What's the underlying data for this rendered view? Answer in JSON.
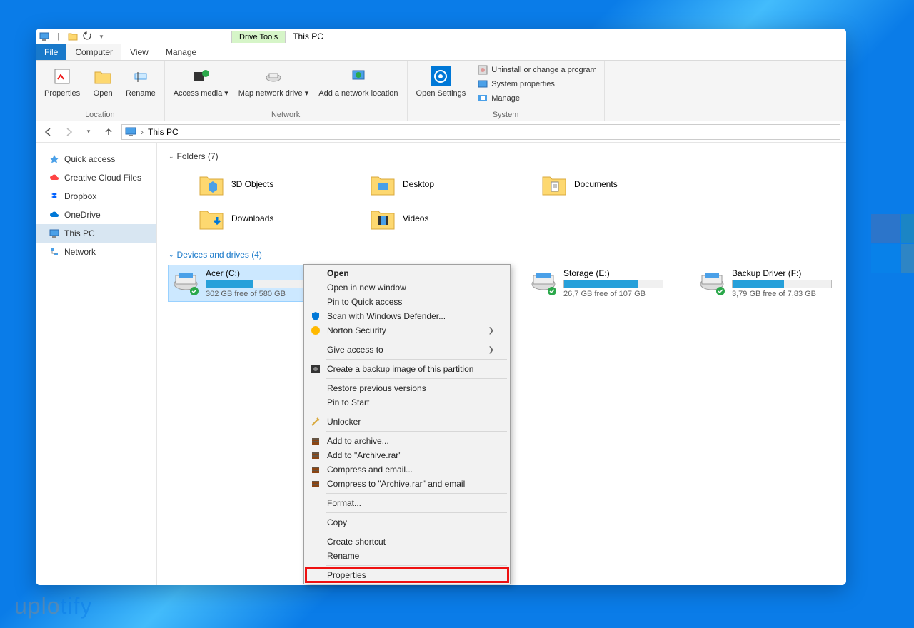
{
  "window": {
    "drive_tools": "Drive Tools",
    "title": "This PC"
  },
  "tabs": {
    "file": "File",
    "computer": "Computer",
    "view": "View",
    "manage": "Manage"
  },
  "ribbon": {
    "location": {
      "properties": "Properties",
      "open": "Open",
      "rename": "Rename",
      "group": "Location"
    },
    "network": {
      "access_media": "Access media",
      "map_drive": "Map network drive",
      "add_location": "Add a network location",
      "group": "Network"
    },
    "system": {
      "open_settings": "Open Settings",
      "uninstall": "Uninstall or change a program",
      "sys_props": "System properties",
      "manage": "Manage",
      "group": "System"
    }
  },
  "breadcrumb": {
    "this_pc": "This PC"
  },
  "sidebar": {
    "items": [
      {
        "label": "Quick access"
      },
      {
        "label": "Creative Cloud Files"
      },
      {
        "label": "Dropbox"
      },
      {
        "label": "OneDrive"
      },
      {
        "label": "This PC"
      },
      {
        "label": "Network"
      }
    ]
  },
  "sections": {
    "folders": {
      "header": "Folders (7)",
      "items": [
        "3D Objects",
        "Desktop",
        "Documents",
        "Downloads",
        "Videos"
      ]
    },
    "devices": {
      "header": "Devices and drives (4)",
      "drives": [
        {
          "name": "Acer (C:)",
          "free": "302 GB free of 580 GB",
          "pct": 48
        },
        {
          "name": "Storage (E:)",
          "free": "26,7 GB free of 107 GB",
          "pct": 75
        },
        {
          "name": "Backup Driver (F:)",
          "free": "3,79 GB free of 7,83 GB",
          "pct": 52
        }
      ]
    }
  },
  "context_menu": {
    "open": "Open",
    "open_new": "Open in new window",
    "pin_quick": "Pin to Quick access",
    "defender": "Scan with Windows Defender...",
    "norton": "Norton Security",
    "give_access": "Give access to",
    "backup_image": "Create a backup image of this partition",
    "restore": "Restore previous versions",
    "pin_start": "Pin to Start",
    "unlocker": "Unlocker",
    "add_archive": "Add to archive...",
    "add_archive_rar": "Add to \"Archive.rar\"",
    "compress_email": "Compress and email...",
    "compress_rar_email": "Compress to \"Archive.rar\" and email",
    "format": "Format...",
    "copy": "Copy",
    "create_shortcut": "Create shortcut",
    "rename": "Rename",
    "properties": "Properties"
  },
  "watermark": {
    "a": "uplo",
    "b": "tify"
  }
}
